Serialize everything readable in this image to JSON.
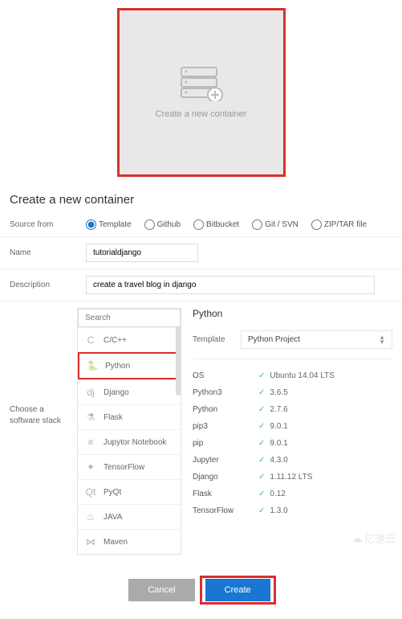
{
  "tile": {
    "text": "Create a new container"
  },
  "page": {
    "title": "Create a new container"
  },
  "form": {
    "source_label": "Source from",
    "name_label": "Name",
    "name_value": "tutorialdjango",
    "desc_label": "Description",
    "desc_value": "create a travel blog in django"
  },
  "sources": [
    {
      "label": "Template",
      "checked": true
    },
    {
      "label": "Github",
      "checked": false
    },
    {
      "label": "Bitbucket",
      "checked": false
    },
    {
      "label": "Git / SVN",
      "checked": false
    },
    {
      "label": "ZIP/TAR file",
      "checked": false
    }
  ],
  "stack": {
    "side_label": "Choose a software stack",
    "search_placeholder": "Search",
    "items": [
      {
        "name": "C/C++",
        "icon": "C"
      },
      {
        "name": "Python",
        "icon": "🐍",
        "selected": true
      },
      {
        "name": "Django",
        "icon": "dj"
      },
      {
        "name": "Flask",
        "icon": "⚗"
      },
      {
        "name": "Jupytor Notebook",
        "icon": "≡"
      },
      {
        "name": "TensorFlow",
        "icon": "✦"
      },
      {
        "name": "PyQt",
        "icon": "Qt"
      },
      {
        "name": "JAVA",
        "icon": "♨"
      },
      {
        "name": "Maven",
        "icon": "⋈"
      }
    ]
  },
  "details": {
    "title": "Python",
    "template_label": "Template",
    "template_value": "Python Project",
    "specs": [
      {
        "key": "OS",
        "val": "Ubuntu 14.04 LTS"
      },
      {
        "key": "Python3",
        "val": "3.6.5"
      },
      {
        "key": "Python",
        "val": "2.7.6"
      },
      {
        "key": "pip3",
        "val": "9.0.1"
      },
      {
        "key": "pip",
        "val": "9.0.1"
      },
      {
        "key": "Jupyter",
        "val": "4.3.0"
      },
      {
        "key": "Django",
        "val": "1.11.12 LTS"
      },
      {
        "key": "Flask",
        "val": "0.12"
      },
      {
        "key": "TensorFlow",
        "val": "1.3.0"
      }
    ]
  },
  "buttons": {
    "cancel": "Cancel",
    "create": "Create"
  },
  "watermark": "亿速云"
}
